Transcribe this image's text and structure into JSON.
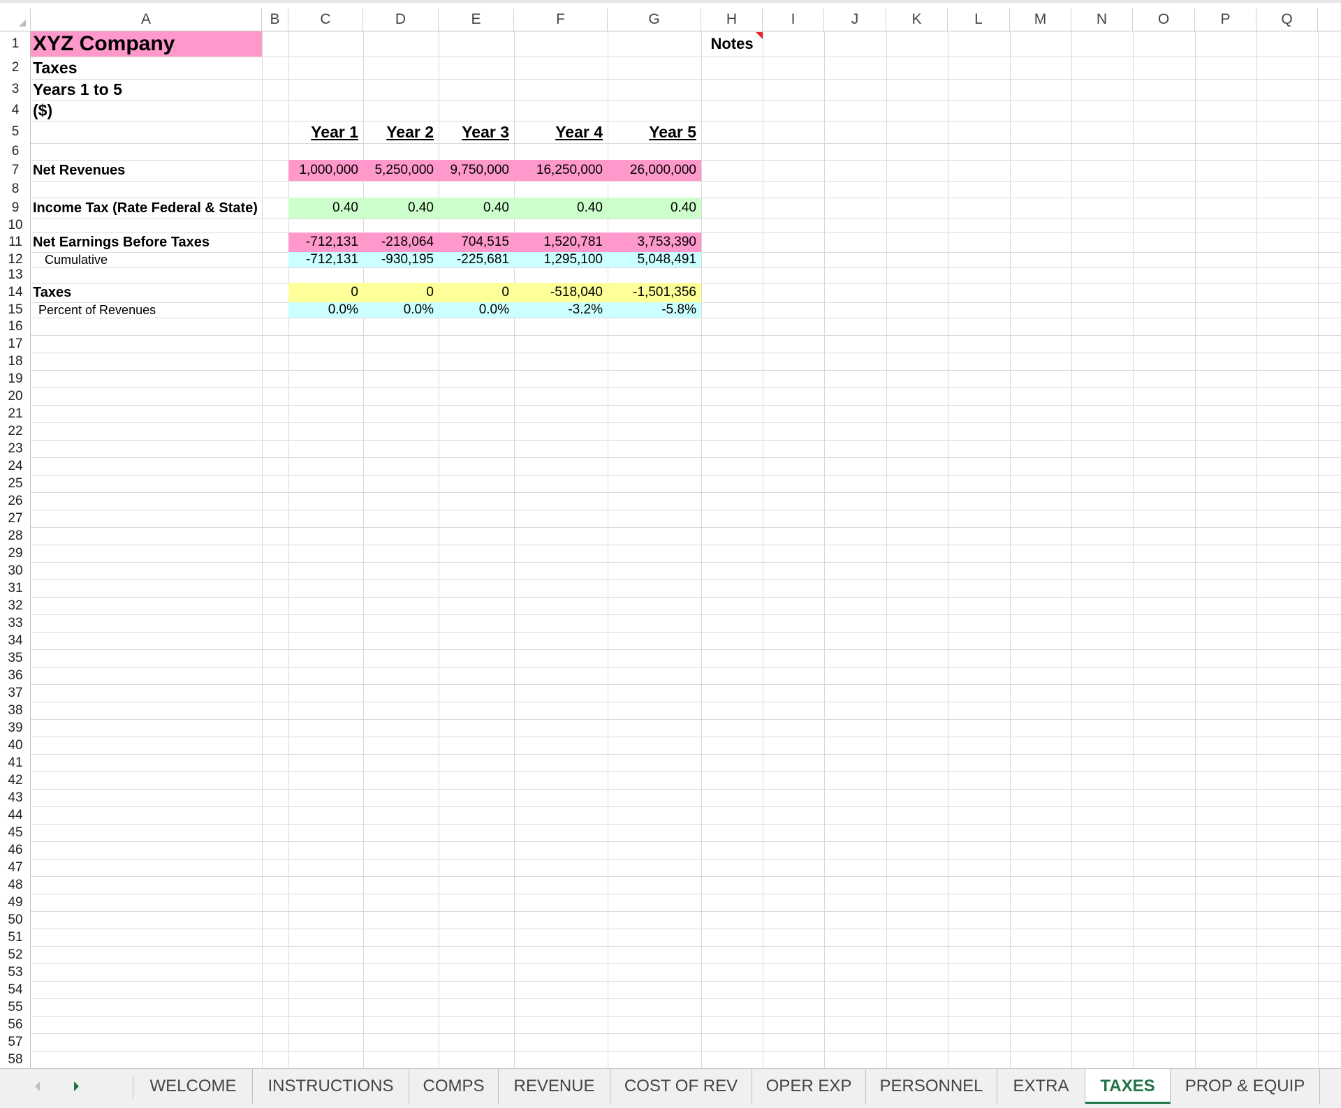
{
  "columns": [
    "A",
    "B",
    "C",
    "D",
    "E",
    "F",
    "G",
    "H",
    "I",
    "J",
    "K",
    "L",
    "M",
    "N",
    "O",
    "P",
    "Q"
  ],
  "rows": [
    "1",
    "2",
    "3",
    "4",
    "5",
    "6",
    "7",
    "8",
    "9",
    "10",
    "11",
    "12",
    "13",
    "14",
    "15",
    "16",
    "17",
    "18",
    "19",
    "20",
    "21",
    "22",
    "23",
    "24",
    "25",
    "26",
    "27",
    "28",
    "29",
    "30",
    "31",
    "32",
    "33",
    "34",
    "35",
    "36",
    "37",
    "38",
    "39",
    "40",
    "41",
    "42",
    "43",
    "44",
    "45",
    "46",
    "47",
    "48",
    "49",
    "50",
    "51",
    "52",
    "53",
    "54",
    "55",
    "56",
    "57",
    "58"
  ],
  "sheet": {
    "company": "XYZ Company",
    "subtitle": "Taxes",
    "period": "Years 1 to 5",
    "units": "($)",
    "notes_label": "Notes",
    "year_headers": [
      "Year 1",
      "Year 2",
      "Year 3",
      "Year 4",
      "Year 5"
    ],
    "net_revenues": {
      "label": "Net Revenues",
      "values": [
        "1,000,000",
        "5,250,000",
        "9,750,000",
        "16,250,000",
        "26,000,000"
      ]
    },
    "income_tax_rate": {
      "label": "Income Tax (Rate Federal & State)",
      "values": [
        "0.40",
        "0.40",
        "0.40",
        "0.40",
        "0.40"
      ]
    },
    "net_earnings": {
      "label": "Net Earnings Before Taxes",
      "values": [
        "-712,131",
        "-218,064",
        "704,515",
        "1,520,781",
        "3,753,390"
      ]
    },
    "cumulative": {
      "label": "Cumulative",
      "values": [
        "-712,131",
        "-930,195",
        "-225,681",
        "1,295,100",
        "5,048,491"
      ]
    },
    "taxes": {
      "label": "Taxes",
      "values": [
        "0",
        "0",
        "0",
        "-518,040",
        "-1,501,356"
      ]
    },
    "pct_revenues": {
      "label": "Percent of Revenues",
      "values": [
        "0.0%",
        "0.0%",
        "0.0%",
        "-3.2%",
        "-5.8%"
      ]
    }
  },
  "tabs": [
    "WELCOME",
    "INSTRUCTIONS",
    "COMPS",
    "REVENUE",
    "COST OF REV",
    "OPER EXP",
    "PERSONNEL",
    "EXTRA",
    "TAXES",
    "PROP & EQUIP"
  ],
  "active_tab": "TAXES",
  "colors": {
    "pink": "#ff99cc",
    "green": "#ccffcc",
    "cyan": "#ccffff",
    "yellow": "#ffff99",
    "accent": "#217346",
    "note_marker": "#e0282e"
  }
}
